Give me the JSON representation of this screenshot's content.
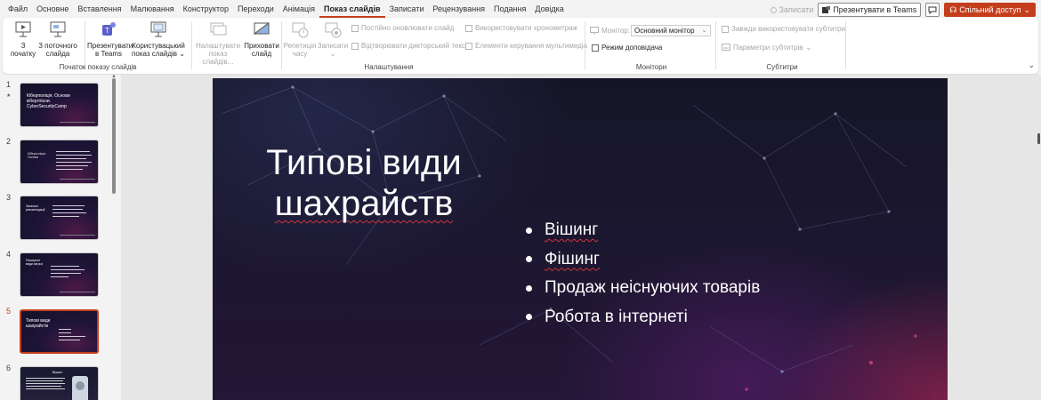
{
  "menu": {
    "tabs": [
      "Файл",
      "Основне",
      "Вставлення",
      "Малювання",
      "Конструктор",
      "Переходи",
      "Анімація",
      "Показ слайдів",
      "Записати",
      "Рецензування",
      "Подання",
      "Довідка"
    ],
    "active_tab": "Показ слайдів",
    "record_label": "Записати",
    "teams_label": "Презентувати в Teams",
    "share_label": "Спільний доступ"
  },
  "ribbon": {
    "start_group": {
      "label": "Початок показу слайдів",
      "from_start_l1": "З",
      "from_start_l2": "початку",
      "from_current_l1": "З поточного",
      "from_current_l2": "слайда",
      "present_teams_l1": "Презентувати",
      "present_teams_l2": "в Teams",
      "custom_show_l1": "Користувацький",
      "custom_show_l2": "показ слайдів"
    },
    "setup_group": {
      "label": "Налаштування",
      "setup_show_l1": "Налаштувати",
      "setup_show_l2": "показ слайдів...",
      "hide_slide_l1": "Приховати",
      "hide_slide_l2": "слайд",
      "rehearse_l1": "Репетиція",
      "rehearse_l2": "часу",
      "record_l1": "Записати",
      "always_update": "Постійно оновлювати слайд",
      "play_narration": "Відтворювати дикторський текст",
      "use_timings": "Використовувати хронометраж",
      "media_controls": "Елементи керування мультимедіа"
    },
    "monitors_group": {
      "label": "Монітори",
      "monitor_label": "Монітор:",
      "monitor_value": "Основний монітор",
      "presenter_view": "Режим доповідача"
    },
    "subtitles_group": {
      "label": "Субтитри",
      "always_subtitles": "Завжди використовувати субтитри",
      "subtitle_params": "Параметри субтитрів"
    }
  },
  "thumbnails": [
    {
      "num": "1",
      "text": "Кіберполіція. Основи кібергігієни. CyberSecurityCamp"
    },
    {
      "num": "2",
      "text": "Кіберполіція. Основи"
    },
    {
      "num": "3",
      "text": "Загальні рекомендації"
    },
    {
      "num": "4",
      "text": "Поширені види загроз"
    },
    {
      "num": "5",
      "text": "Типові види шахрайств"
    },
    {
      "num": "6",
      "text": "Вішинг"
    }
  ],
  "slide": {
    "title_line1": "Типові види",
    "title_line2": "шахрайств",
    "bullets": [
      "Вішинг",
      "Фішинг",
      "Продаж неіснуючих товарів",
      "Робота в інтернеті"
    ]
  },
  "colors": {
    "accent": "#c43e1c",
    "spellcheck": "#d1343b"
  }
}
